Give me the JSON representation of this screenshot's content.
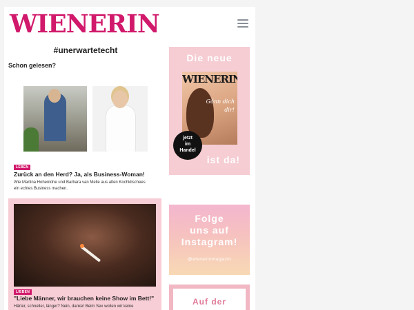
{
  "header": {
    "logo": "WIENERIN",
    "menu_icon": "hamburger-menu-icon"
  },
  "main": {
    "hashtag": "#unerwartetecht",
    "section_title": "Schon gelesen?",
    "articles": [
      {
        "badge": "LEBEN",
        "title": "Zurück an den Herd? Ja, als Business-Woman!",
        "teaser": "Wie Martina Hohenlohe und Barbara van Melle aus alten Kochklischees ein echtes Business machen."
      },
      {
        "badge": "LIEBEN",
        "title": "\"Liebe Männer, wir brauchen keine Show im Bett!\"",
        "teaser": "Härter, schneller, länger? Nein, danke! Beim Sex wollen wir keine"
      }
    ]
  },
  "sidebar": {
    "ad_magazine": {
      "top_text": "Die neue",
      "cover_logo": "WIENERIN",
      "cover_slogan": "Gönn dich",
      "cover_slogan_2": "dir!",
      "circle_text_1": "jetzt",
      "circle_text_2": "im",
      "circle_text_3": "Handel",
      "bottom_text": "ist da!"
    },
    "ad_instagram": {
      "line1": "Folge",
      "line2": "uns auf",
      "line3": "Instagram!",
      "handle": "@wienerinmagazin"
    },
    "ad_third": {
      "text": "Auf der"
    }
  },
  "colors": {
    "brand": "#d1196b",
    "ad_pink": "#f5cdd3",
    "article_box": "#f7cdd6"
  }
}
